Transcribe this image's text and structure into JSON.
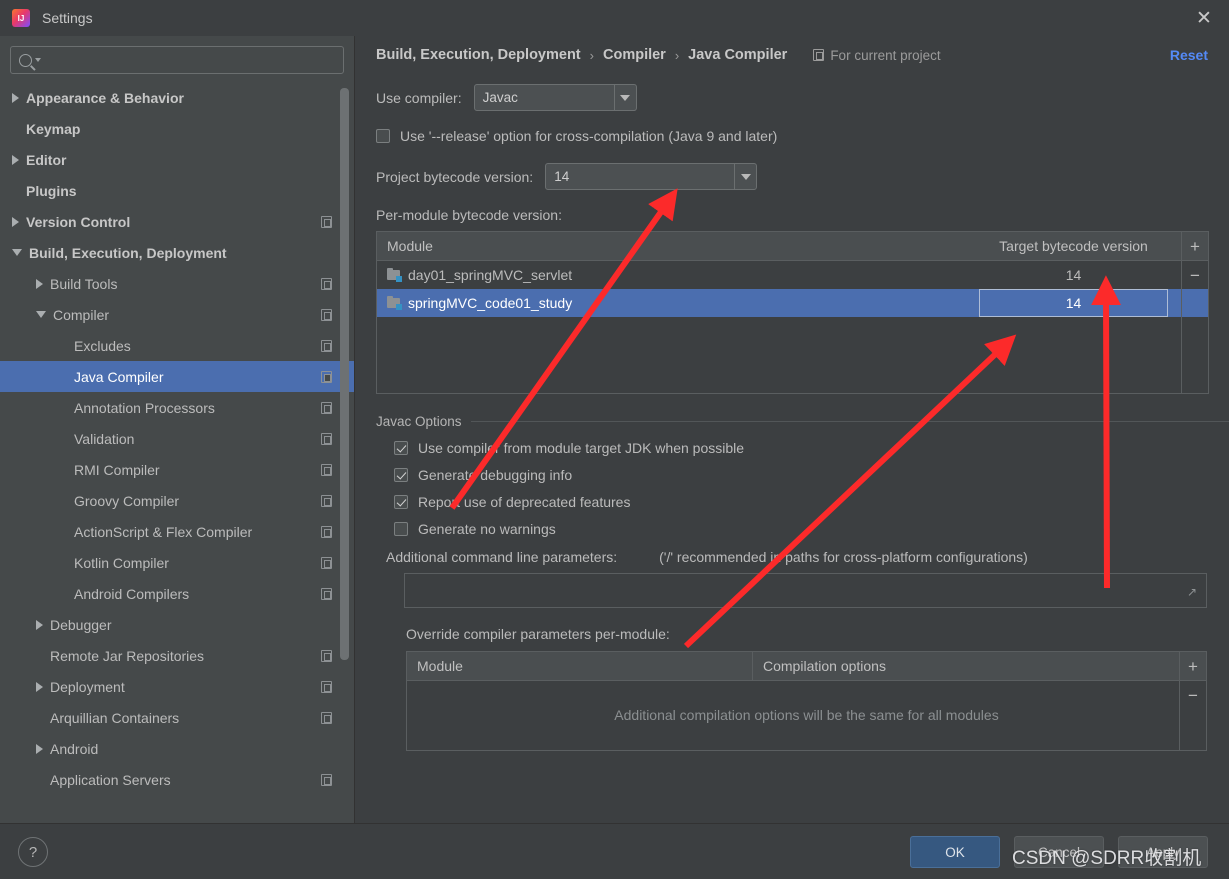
{
  "window": {
    "title": "Settings",
    "logo_icon": "intellij-idea-logo",
    "close_icon": "close-icon"
  },
  "search": {
    "value": "",
    "placeholder": "",
    "icon": "search-icon",
    "caret_icon": "chevron-down-icon"
  },
  "sidebar": {
    "items": [
      {
        "label": "Appearance & Behavior",
        "twisty": "closed",
        "indent": 0,
        "bold": true,
        "badge": false,
        "selected": false
      },
      {
        "label": "Keymap",
        "twisty": "none",
        "indent": 0,
        "bold": true,
        "badge": false,
        "selected": false
      },
      {
        "label": "Editor",
        "twisty": "closed",
        "indent": 0,
        "bold": true,
        "badge": false,
        "selected": false
      },
      {
        "label": "Plugins",
        "twisty": "none",
        "indent": 0,
        "bold": true,
        "badge": false,
        "selected": false
      },
      {
        "label": "Version Control",
        "twisty": "closed",
        "indent": 0,
        "bold": true,
        "badge": true,
        "selected": false
      },
      {
        "label": "Build, Execution, Deployment",
        "twisty": "open",
        "indent": 0,
        "bold": true,
        "badge": false,
        "selected": false
      },
      {
        "label": "Build Tools",
        "twisty": "closed",
        "indent": 1,
        "bold": false,
        "badge": true,
        "selected": false
      },
      {
        "label": "Compiler",
        "twisty": "open",
        "indent": 1,
        "bold": false,
        "badge": true,
        "selected": false
      },
      {
        "label": "Excludes",
        "twisty": "none",
        "indent": 2,
        "bold": false,
        "badge": true,
        "selected": false
      },
      {
        "label": "Java Compiler",
        "twisty": "none",
        "indent": 2,
        "bold": false,
        "badge": true,
        "selected": true
      },
      {
        "label": "Annotation Processors",
        "twisty": "none",
        "indent": 2,
        "bold": false,
        "badge": true,
        "selected": false
      },
      {
        "label": "Validation",
        "twisty": "none",
        "indent": 2,
        "bold": false,
        "badge": true,
        "selected": false
      },
      {
        "label": "RMI Compiler",
        "twisty": "none",
        "indent": 2,
        "bold": false,
        "badge": true,
        "selected": false
      },
      {
        "label": "Groovy Compiler",
        "twisty": "none",
        "indent": 2,
        "bold": false,
        "badge": true,
        "selected": false
      },
      {
        "label": "ActionScript & Flex Compiler",
        "twisty": "none",
        "indent": 2,
        "bold": false,
        "badge": true,
        "selected": false
      },
      {
        "label": "Kotlin Compiler",
        "twisty": "none",
        "indent": 2,
        "bold": false,
        "badge": true,
        "selected": false
      },
      {
        "label": "Android Compilers",
        "twisty": "none",
        "indent": 2,
        "bold": false,
        "badge": true,
        "selected": false
      },
      {
        "label": "Debugger",
        "twisty": "closed",
        "indent": 1,
        "bold": false,
        "badge": false,
        "selected": false
      },
      {
        "label": "Remote Jar Repositories",
        "twisty": "none",
        "indent": 1,
        "bold": false,
        "badge": true,
        "selected": false
      },
      {
        "label": "Deployment",
        "twisty": "closed",
        "indent": 1,
        "bold": false,
        "badge": true,
        "selected": false
      },
      {
        "label": "Arquillian Containers",
        "twisty": "none",
        "indent": 1,
        "bold": false,
        "badge": true,
        "selected": false
      },
      {
        "label": "Android",
        "twisty": "closed",
        "indent": 1,
        "bold": false,
        "badge": false,
        "selected": false
      },
      {
        "label": "Application Servers",
        "twisty": "none",
        "indent": 1,
        "bold": false,
        "badge": true,
        "selected": false
      }
    ]
  },
  "breadcrumb": {
    "part1": "Build, Execution, Deployment",
    "part2": "Compiler",
    "part3": "Java Compiler",
    "separator": "›",
    "scope_label": "For current project",
    "scope_icon": "project-scope-icon",
    "reset_label": "Reset"
  },
  "compiler": {
    "use_compiler_label": "Use compiler:",
    "use_compiler_value": "Javac",
    "release_option_label": "Use '--release' option for cross-compilation (Java 9 and later)",
    "release_option_checked": false,
    "project_bytecode_label": "Project bytecode version:",
    "project_bytecode_value": "14",
    "per_module_label": "Per-module bytecode version:",
    "add_icon": "plus-icon",
    "remove_icon": "minus-icon"
  },
  "module_table": {
    "headers": [
      "Module",
      "Target bytecode version"
    ],
    "rows": [
      {
        "module": "day01_springMVC_servlet",
        "target": "14",
        "selected": false,
        "editing": false
      },
      {
        "module": "springMVC_code01_study",
        "target": "14",
        "selected": true,
        "editing": true
      }
    ]
  },
  "javac_options": {
    "group_title": "Javac Options",
    "checkboxes": [
      {
        "label": "Use compiler from module target JDK when possible",
        "checked": true
      },
      {
        "label": "Generate debugging info",
        "checked": true
      },
      {
        "label": "Report use of deprecated features",
        "checked": true
      },
      {
        "label": "Generate no warnings",
        "checked": false
      }
    ],
    "additional_params_label": "Additional command line parameters:",
    "additional_params_hint": "('/' recommended in paths for cross-platform configurations)",
    "additional_params_value": "",
    "expand_icon": "expand-icon"
  },
  "override_section": {
    "label": "Override compiler parameters per-module:",
    "headers": [
      "Module",
      "Compilation options"
    ],
    "empty_message": "Additional compilation options will be the same for all modules",
    "add_icon": "plus-icon",
    "remove_icon": "minus-icon"
  },
  "footer": {
    "help_label": "?",
    "ok_label": "OK",
    "cancel_label": "Cancel",
    "apply_label": "Apply"
  },
  "annotations": {
    "watermark": "CSDN @SDRR收割机",
    "arrow_color": "#fc2a2a"
  },
  "colors": {
    "accent_blue": "#4b6eaf",
    "link_blue": "#548af7",
    "primary_button": "#365880",
    "background": "#3c3f41",
    "sidebar_background": "#45494a"
  }
}
